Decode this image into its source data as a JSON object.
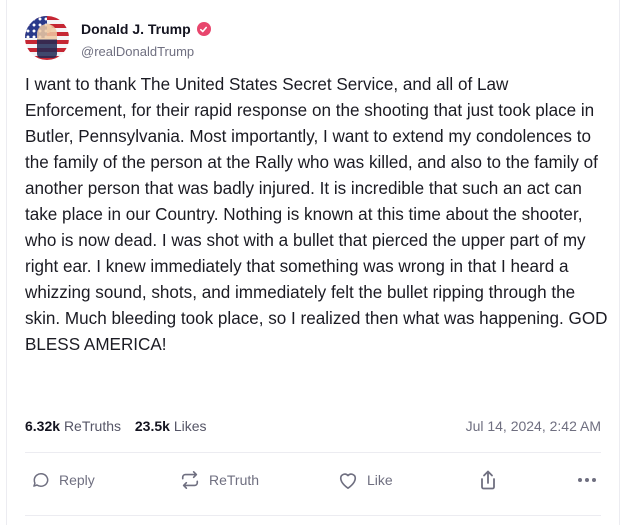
{
  "author": {
    "display_name": "Donald J. Trump",
    "handle": "@realDonaldTrump"
  },
  "post": {
    "text": "I want to thank The United States Secret Service, and all of Law Enforcement, for their rapid response on the shooting that just took place in Butler, Pennsylvania. Most importantly, I want to extend my condolences to the family of the person at the Rally who was killed, and also to the family of another person that was badly injured. It is incredible that such an act can take place in our Country. Nothing is known at this time about the shooter, who is now dead. I was shot with a bullet that pierced the upper part of my right ear. I knew immediately that something was wrong in that I heard a whizzing sound, shots, and immediately felt the bullet ripping through the skin. Much bleeding took place, so I realized then what was happening. GOD BLESS AMERICA!",
    "retruths_count": "6.32k",
    "retruths_label": "ReTruths",
    "likes_count": "23.5k",
    "likes_label": "Likes",
    "timestamp": "Jul 14, 2024, 2:42 AM"
  },
  "actions": {
    "reply_label": "Reply",
    "retruth_label": "ReTruth",
    "like_label": "Like"
  },
  "icons": {
    "verified": "verified-badge-icon",
    "reply": "speech-bubble-icon",
    "retruth": "repost-arrows-icon",
    "like": "heart-icon",
    "share": "share-upload-icon",
    "more": "ellipsis-icon"
  },
  "colors": {
    "verified_badge": "#e8466d",
    "muted_text": "#6f6f80",
    "body_text": "#1b1b23"
  }
}
